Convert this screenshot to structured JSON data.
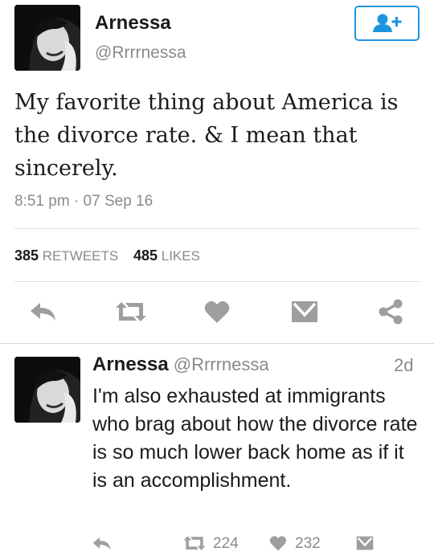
{
  "tweet": {
    "display_name": "Arnessa",
    "handle": "@Rrrrnessa",
    "text": "My favorite thing about America is the divorce rate. & I mean that sincerely.",
    "timestamp": "8:51 pm · 07 Sep 16",
    "retweets_count": "385",
    "retweets_label": "RETWEETS",
    "likes_count": "485",
    "likes_label": "LIKES"
  },
  "reply": {
    "display_name": "Arnessa",
    "handle": "@Rrrrnessa",
    "age": "2d",
    "text": "I'm also exhausted at immigrants who brag about how the divorce rate is so much lower back home as if it is an accomplishment.",
    "retweet_count": "224",
    "like_count": "232"
  },
  "icons": [
    "follow-icon",
    "reply-icon",
    "retweet-icon",
    "like-icon",
    "message-icon",
    "share-icon"
  ],
  "colors": {
    "accent": "#1b95e0",
    "icon_gray": "#9e9e9e",
    "text_secondary": "#8a8a8a"
  }
}
